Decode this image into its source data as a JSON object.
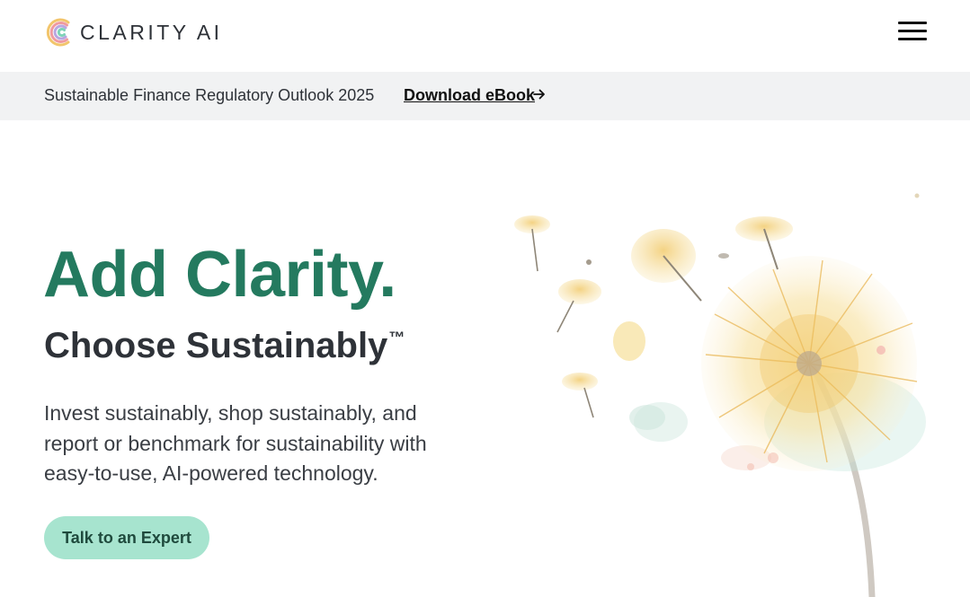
{
  "header": {
    "logo_text": "CLARITY AI",
    "logo_icon": "clarity-c-logo-icon",
    "menu_icon": "hamburger-menu-icon"
  },
  "banner": {
    "text": "Sustainable Finance Regulatory Outlook 2025",
    "link_label": "Download eBook",
    "link_icon": "arrow-right-icon"
  },
  "hero": {
    "title": "Add Clarity.",
    "subtitle": "Choose Sustainably",
    "subtitle_mark": "™",
    "body": "Invest sustainably, shop sustainably, and report or benchmark for sustainability with easy-to-use, AI-powered technology.",
    "cta_label": "Talk to an Expert",
    "illustration": "dandelion-watercolor-illustration"
  },
  "colors": {
    "brand_green": "#247a5f",
    "cta_background": "#a7e4cf",
    "banner_background": "#f1f2f3",
    "text_dark": "#2e3238"
  }
}
